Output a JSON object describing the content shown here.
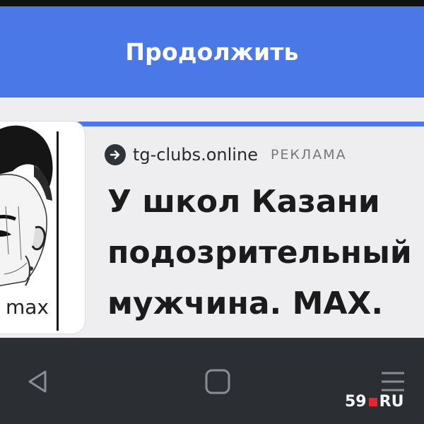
{
  "continue_button": {
    "label": "Продолжить"
  },
  "ad": {
    "source_domain": "tg-clubs.online",
    "ad_label": "РЕКЛАМА",
    "headline_lines": [
      "У школ Казани",
      "подозрительный",
      "мужчина. MAX."
    ],
    "thumbnail_caption": "max"
  },
  "nav": {
    "back_icon": "triangle-back-icon",
    "home_icon": "rounded-square-home-icon",
    "menu_icon": "three-lines-menu-icon"
  },
  "watermark": {
    "left": "59",
    "right": "RU"
  },
  "colors": {
    "accent": "#4a78e6",
    "nav_bg": "#2b2e33",
    "brand_red": "#e3262f"
  }
}
